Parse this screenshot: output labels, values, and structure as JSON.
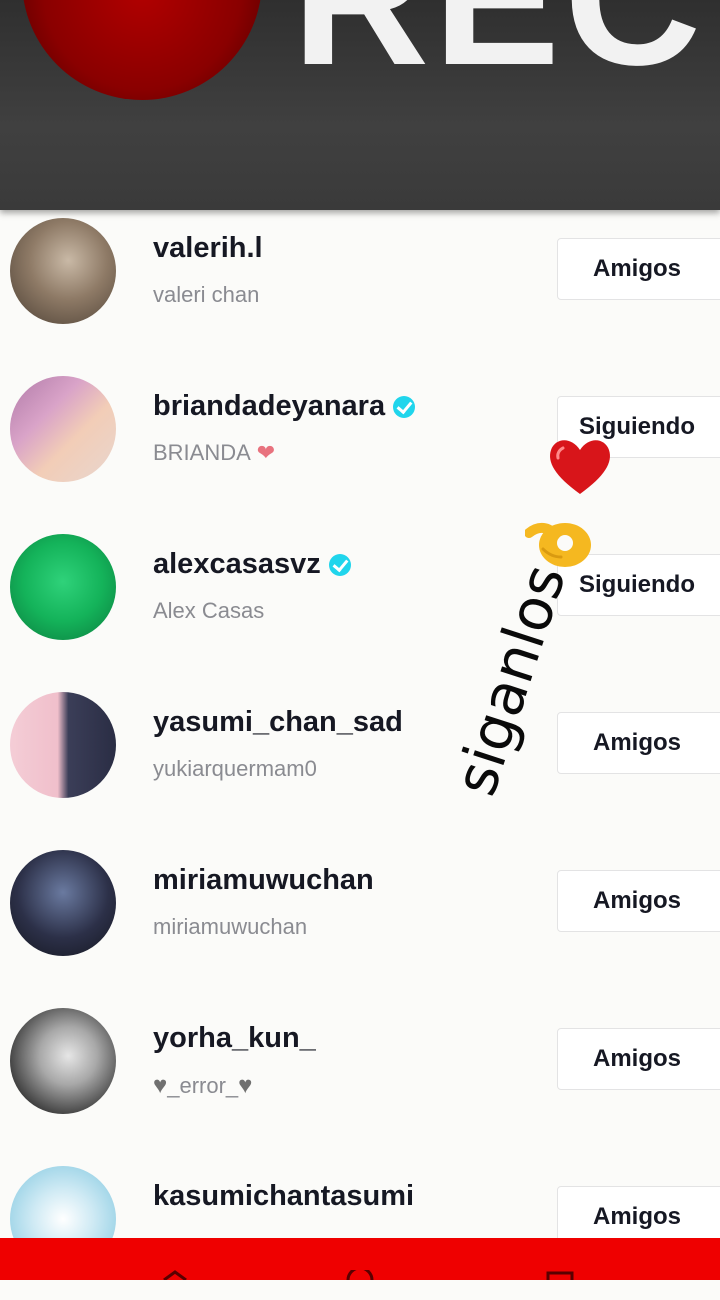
{
  "banner": {
    "rec_label": "REC"
  },
  "users": [
    {
      "username": "valerih.l",
      "nickname": "valeri chan",
      "verified": false,
      "button": "Amigos",
      "avatar_colors": [
        "#6b5a4a",
        "#c9b9a6"
      ]
    },
    {
      "username": "briandadeyanara",
      "nickname": "BRIANDA",
      "nickname_suffix": "❤",
      "verified": true,
      "button": "Siguiendo",
      "avatar_colors": [
        "#c98fb6",
        "#f0c6b0"
      ]
    },
    {
      "username": "alexcasasvz",
      "nickname": "Alex Casas",
      "verified": true,
      "button": "Siguiendo",
      "avatar_colors": [
        "#12b65a",
        "#0c7a3c"
      ]
    },
    {
      "username": "yasumi_chan_sad",
      "nickname": "yukiarquermam0",
      "verified": false,
      "button": "Amigos",
      "avatar_colors": [
        "#f2c6cf",
        "#3c3f59"
      ]
    },
    {
      "username": "miriamuwuchan",
      "nickname": "miriamuwuchan",
      "verified": false,
      "button": "Amigos",
      "avatar_colors": [
        "#1d1f2e",
        "#5a6a8a"
      ]
    },
    {
      "username": "yorha_kun_",
      "nickname": "_error_",
      "nickname_prefix": "♥",
      "nickname_suffix": "♥",
      "verified": false,
      "button": "Amigos",
      "avatar_colors": [
        "#2a2a2a",
        "#d6d6d6"
      ]
    },
    {
      "username": "kasumichantasumi",
      "nickname": "",
      "verified": false,
      "button": "Amigos",
      "avatar_colors": [
        "#9fd4e6",
        "#f4f4f4"
      ]
    }
  ],
  "overlay": {
    "text": "siganlos"
  },
  "colors": {
    "bottom_bar": "#ef0000",
    "verified": "#20d5ec",
    "username": "#161823",
    "nickname": "#8a8b91"
  }
}
